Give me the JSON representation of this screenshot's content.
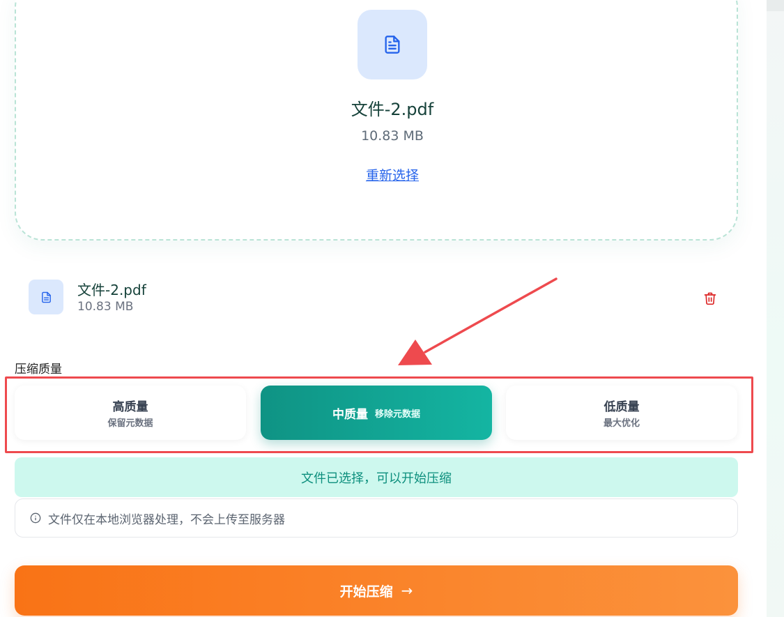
{
  "upload": {
    "file_name": "文件-2.pdf",
    "file_size": "10.83 MB",
    "reselect_label": "重新选择",
    "icon": "file-text-icon"
  },
  "selected_file": {
    "name": "文件-2.pdf",
    "size": "10.83 MB",
    "icon": "file-text-icon",
    "delete_icon": "trash-icon"
  },
  "quality": {
    "label": "压缩质量",
    "options": [
      {
        "title": "高质量",
        "subtitle": "保留元数据",
        "selected": false
      },
      {
        "title": "中质量",
        "subtitle": "移除元数据",
        "selected": true
      },
      {
        "title": "低质量",
        "subtitle": "最大优化",
        "selected": false
      }
    ]
  },
  "status_text": "文件已选择，可以开始压缩",
  "notice": {
    "icon": "info-icon",
    "text": "文件仅在本地浏览器处理，不会上传至服务器"
  },
  "start_button": {
    "label": "开始压缩",
    "arrow": "→",
    "icon": "arrow-right-icon"
  },
  "annotation": {
    "arrow_color": "#ee4a4e",
    "box_color": "#ee4a4e"
  },
  "colors": {
    "accent_teal": "#14b5a2",
    "accent_orange": "#f97316",
    "link_blue": "#2563eb",
    "danger_red": "#dc2626"
  }
}
